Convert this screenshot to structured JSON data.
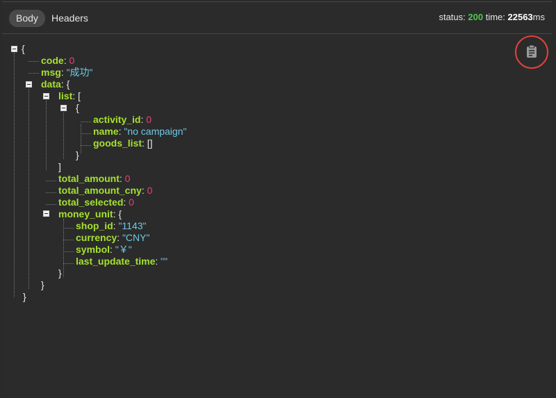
{
  "tabs": {
    "body": "Body",
    "headers": "Headers"
  },
  "status": {
    "status_label": "status:",
    "status_code": "200",
    "time_label": "time:",
    "time_value": "22563",
    "time_unit": "ms"
  },
  "toolbar": {
    "copy_icon": "clipboard-icon"
  },
  "json": {
    "open_root": "{",
    "code_key": "code",
    "code_val": "0",
    "msg_key": "msg",
    "msg_val": "\"成功\"",
    "data_key": "data",
    "data_open": "{",
    "list_key": "list",
    "list_open": "[",
    "item_open": "{",
    "activity_id_key": "activity_id",
    "activity_id_val": "0",
    "name_key": "name",
    "name_val": "\"no campaign\"",
    "goods_list_key": "goods_list",
    "goods_list_val": "[]",
    "item_close": "}",
    "list_close": "]",
    "total_amount_key": "total_amount",
    "total_amount_val": "0",
    "total_amount_cny_key": "total_amount_cny",
    "total_amount_cny_val": "0",
    "total_selected_key": "total_selected",
    "total_selected_val": "0",
    "money_unit_key": "money_unit",
    "money_unit_open": "{",
    "shop_id_key": "shop_id",
    "shop_id_val": "\"1143\"",
    "currency_key": "currency",
    "currency_val": "\"CNY\"",
    "symbol_key": "symbol",
    "symbol_val": "\"￥\"",
    "last_update_time_key": "last_update_time",
    "last_update_time_val": "\"\"",
    "money_unit_close": "}",
    "data_close": "}",
    "close_root": "}",
    "colon": ":"
  },
  "colors": {
    "key": "#a6e22e",
    "number": "#e6417a",
    "string": "#6ec9e8",
    "status_ok": "#4ec94e",
    "highlight_ring": "#e0443a"
  }
}
